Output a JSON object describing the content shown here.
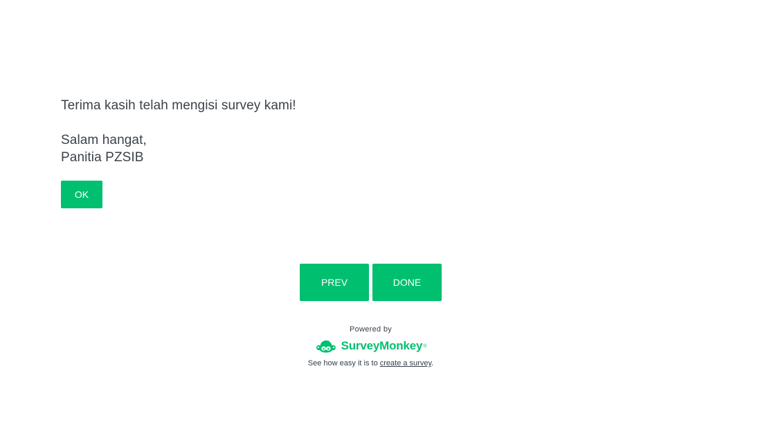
{
  "message": {
    "line1": "Terima kasih telah mengisi survey kami!",
    "line2": "Salam hangat,",
    "line3": "Panitia PZSIB"
  },
  "ok_button": {
    "label": "OK"
  },
  "navigation": {
    "prev_label": "PREV",
    "done_label": "DONE"
  },
  "footer": {
    "powered_by": "Powered by",
    "brand_name": "SurveyMonkey",
    "brand_tm": "®",
    "tagline_prefix": "See how easy it is to ",
    "tagline_link": "create a survey",
    "tagline_suffix": "."
  },
  "colors": {
    "accent": "#00bf6f",
    "text": "#333e48"
  },
  "icons": {
    "brand_logo": "surveymonkey-logo-icon"
  }
}
